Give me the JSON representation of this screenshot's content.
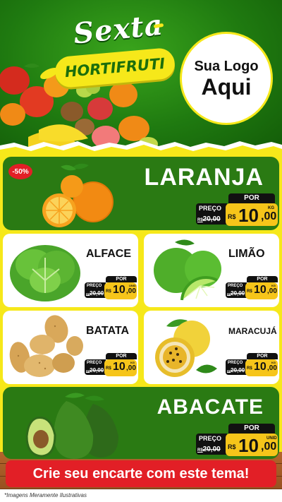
{
  "header": {
    "day": "Sexta",
    "category": "HORTIFRUTI",
    "logo_line1": "Sua Logo",
    "logo_line2": "Aqui"
  },
  "featured_top": {
    "discount_badge": "-50%",
    "name": "LARANJA",
    "por_label": "POR",
    "preco_label": "PREÇO",
    "old_prefix": "R$",
    "old_price": "20,00",
    "currency": "R$",
    "price_int": "10",
    "price_dec": ",00",
    "unit": "KG"
  },
  "products": [
    {
      "name": "ALFACE",
      "por_label": "POR",
      "preco_label": "PREÇO",
      "old_prefix": "R$",
      "old_price": "20,00",
      "currency": "R$",
      "price_int": "10",
      "price_dec": ",00",
      "unit": "UNID"
    },
    {
      "name": "LIMÃO",
      "por_label": "POR",
      "preco_label": "PREÇO",
      "old_prefix": "R$",
      "old_price": "20,00",
      "currency": "R$",
      "price_int": "10",
      "price_dec": ",00",
      "unit": "KG"
    },
    {
      "name": "BATATA",
      "por_label": "POR",
      "preco_label": "PREÇO",
      "old_prefix": "R$",
      "old_price": "20,00",
      "currency": "R$",
      "price_int": "10",
      "price_dec": ",00",
      "unit": "KG"
    },
    {
      "name": "MARACUJÁ",
      "por_label": "POR",
      "preco_label": "PREÇO",
      "old_prefix": "R$",
      "old_price": "20,00",
      "currency": "R$",
      "price_int": "10",
      "price_dec": ",00",
      "unit": "KG"
    }
  ],
  "featured_bottom": {
    "name": "ABACATE",
    "por_label": "POR",
    "preco_label": "PREÇO",
    "old_prefix": "R$",
    "old_price": "20,00",
    "currency": "R$",
    "price_int": "10",
    "price_dec": ",00",
    "unit": "UNID"
  },
  "cta": "Crie seu encarte com este tema!",
  "disclaimer": "*Imagens Meramente Ilustrativas",
  "colors": {
    "green": "#2a7a13",
    "yellow": "#f6e81a",
    "gold": "#f6c51a",
    "red": "#e21f26"
  }
}
